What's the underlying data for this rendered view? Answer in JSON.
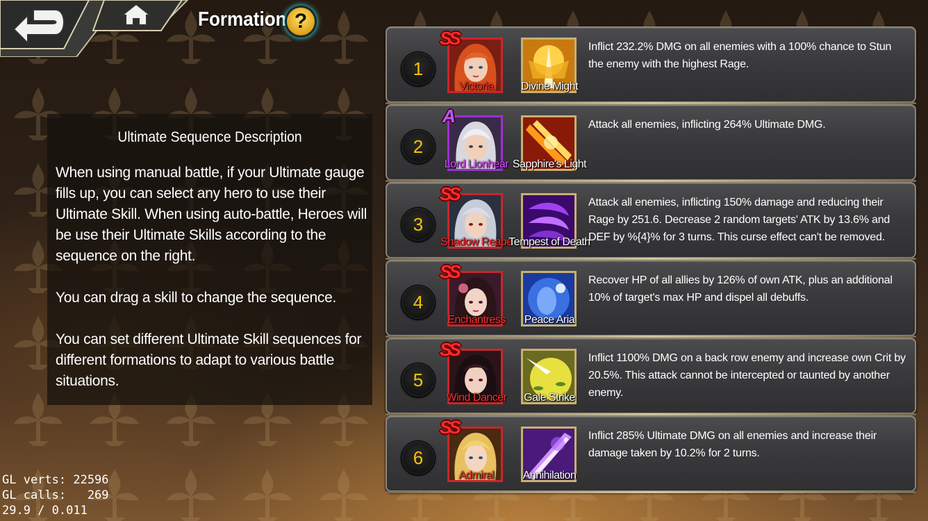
{
  "header": {
    "title": "Formation",
    "help_label": "?",
    "back_icon": "back-arrow-icon",
    "home_icon": "home-icon"
  },
  "description": {
    "title": "Ultimate Sequence Description",
    "paragraphs": [
      "When using manual battle, if your Ultimate gauge fills up, you can select any hero to use their Ultimate Skill. When using auto-battle, Heroes will be use their Ultimate Skills according to the sequence on the right.",
      "You can drag a skill to change the sequence.",
      "You can set different Ultimate Skill sequences for different formations to adapt to various battle situations."
    ]
  },
  "sequence": [
    {
      "order": "1",
      "rank": "SS",
      "rank_color": "#ff2b2b",
      "hero": "Victoria",
      "skill": "Divine Might",
      "effect": "Inflict 232.2% DMG on all enemies with a 100% chance to Stun the enemy with the highest Rage."
    },
    {
      "order": "2",
      "rank": "A",
      "rank_color": "#b060ff",
      "hero": "Lord Lionhear",
      "skill": "Sapphire's Light",
      "effect": "Attack all enemies, inflicting 264% Ultimate DMG."
    },
    {
      "order": "3",
      "rank": "SS",
      "rank_color": "#ff2b2b",
      "hero": "Shadow Reape",
      "skill": "Tempest of Death",
      "effect": "Attack all enemies, inflicting 150% damage and reducing their Rage by 251.6. Decrease 2 random targets' ATK by 13.6% and DEF by %{4}% for 3 turns. This curse effect can't be removed."
    },
    {
      "order": "4",
      "rank": "SS",
      "rank_color": "#ff2b2b",
      "hero": "Enchantress",
      "skill": "Peace Aria",
      "effect": "Recover HP of all allies by 126% of own ATK, plus an additional 10% of target's max HP and dispel all debuffs."
    },
    {
      "order": "5",
      "rank": "SS",
      "rank_color": "#ff2b2b",
      "hero": "Wind Dancer",
      "skill": "Gale Strike",
      "effect": "Inflict 1100% DMG on a back row enemy and increase own Crit by 20.5%. This attack cannot be intercepted or taunted by another enemy."
    },
    {
      "order": "6",
      "rank": "SS",
      "rank_color": "#ff2b2b",
      "hero": "Admiral",
      "skill": "Annihilation",
      "effect": "Inflict 285% Ultimate DMG on all enemies and increase their damage taken by 10.2% for 2 turns."
    }
  ],
  "debug": {
    "line1": "GL verts: 22596",
    "line2": "GL calls:   269",
    "line3": "29.9 / 0.011"
  }
}
